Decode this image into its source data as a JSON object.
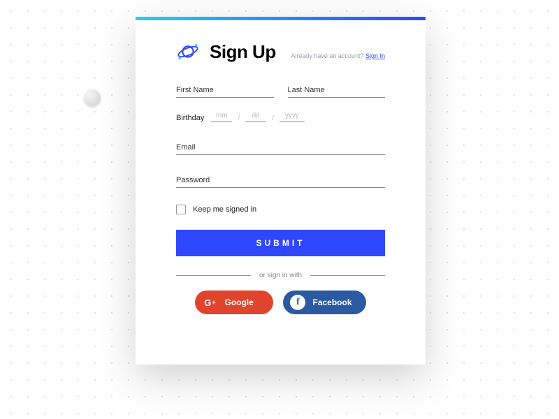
{
  "header": {
    "title": "Sign Up",
    "already_text": "Already have an account? ",
    "signin_link": "Sign In"
  },
  "fields": {
    "first_name_placeholder": "First Name",
    "last_name_placeholder": "Last Name",
    "birthday_label": "Birthday",
    "mm_placeholder": "mm",
    "dd_placeholder": "dd",
    "yyyy_placeholder": "yyyy",
    "slash": "/",
    "email_placeholder": "Email",
    "password_placeholder": "Password"
  },
  "keep_signed_label": "Keep me signed in",
  "submit_label": "SUBMIT",
  "divider_text": "or sign in with",
  "social": {
    "google_label": "Google",
    "facebook_label": "Facebook"
  },
  "icons": {
    "logo": "planet-icon",
    "google": "google-plus-icon",
    "facebook": "facebook-icon"
  },
  "colors": {
    "primary": "#2f47ff",
    "gradient_start": "#22d3ee",
    "gradient_end": "#2f47ff",
    "google": "#e0442c",
    "facebook": "#2b5aa3"
  }
}
